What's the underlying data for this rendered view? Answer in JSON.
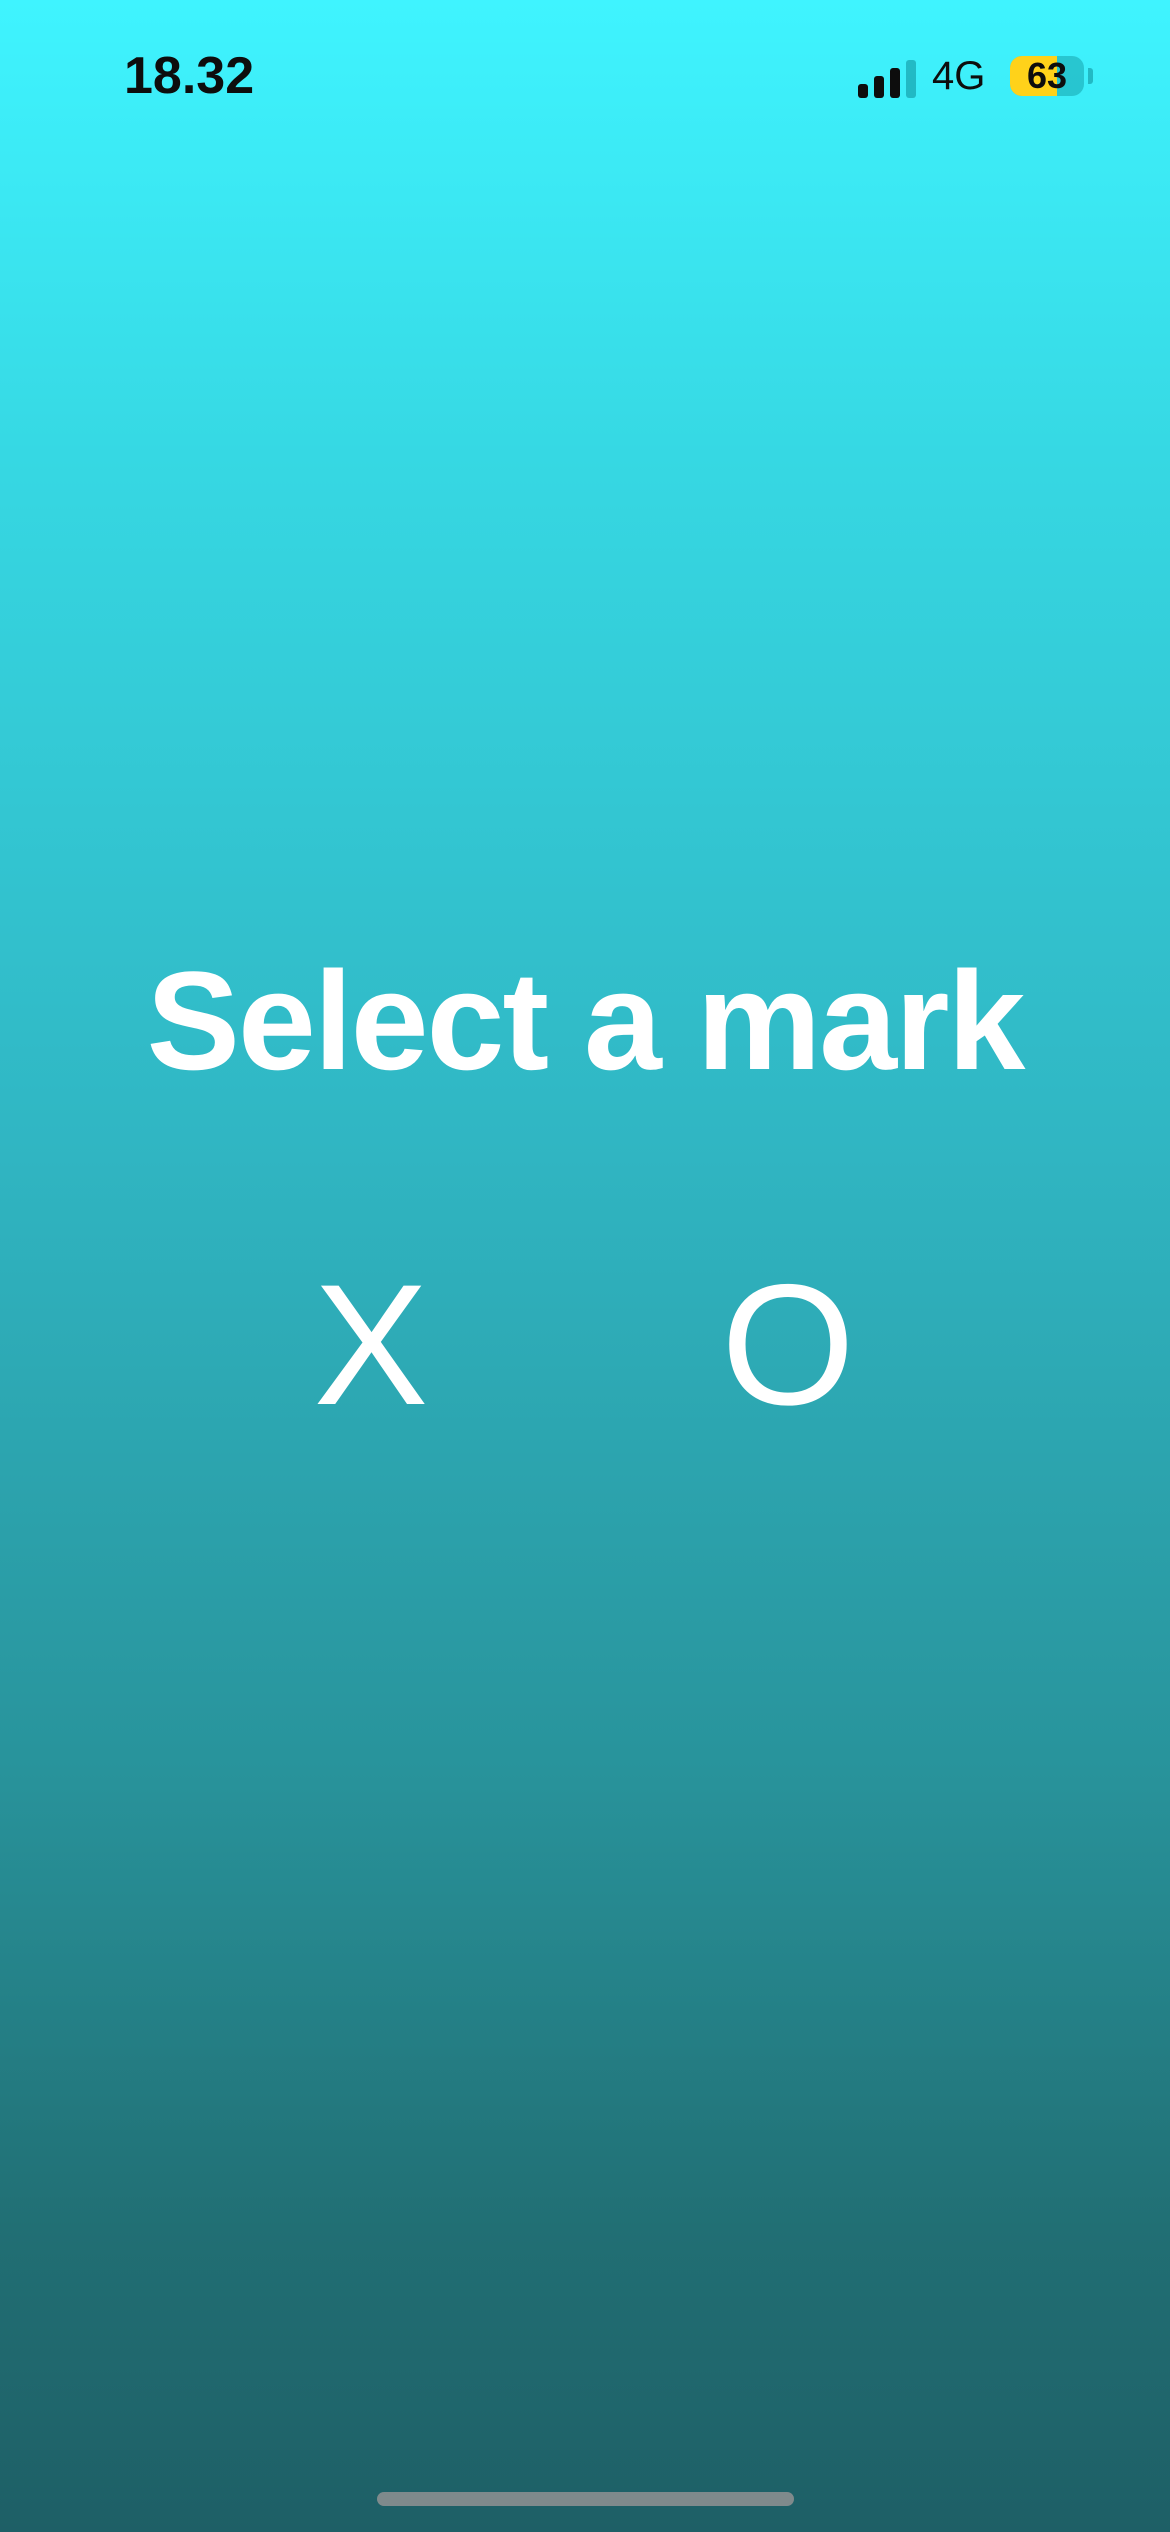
{
  "status_bar": {
    "time": "18.32",
    "network": "4G",
    "battery_level": 63,
    "battery_text": "63",
    "signal_bars_active": 3,
    "signal_bars_total": 4,
    "signal_icon": "cellular-signal-icon",
    "battery_icon": "battery-icon"
  },
  "main": {
    "title": "Select a mark",
    "marks": [
      {
        "label": "X"
      },
      {
        "label": "O"
      }
    ]
  },
  "colors": {
    "gradient_top": "#3ff4ff",
    "gradient_bottom": "#1e5f66",
    "text": "#ffffff",
    "battery_fill": "#ffd21a"
  }
}
